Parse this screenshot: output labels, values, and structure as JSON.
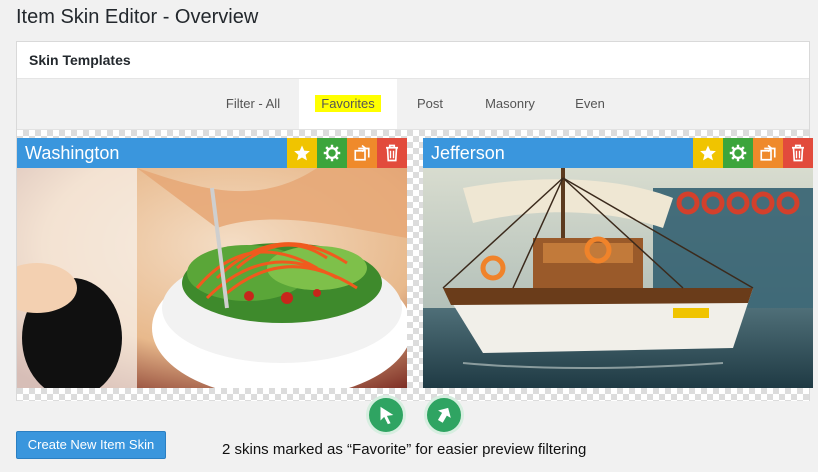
{
  "page": {
    "title": "Item Skin Editor - Overview"
  },
  "panel": {
    "title": "Skin Templates"
  },
  "filters": [
    {
      "label": "Filter - All",
      "active": false
    },
    {
      "label": "Favorites",
      "active": true
    },
    {
      "label": "Post",
      "active": false
    },
    {
      "label": "Masonry",
      "active": false
    },
    {
      "label": "Even",
      "active": false
    }
  ],
  "skins": [
    {
      "name": "Washington",
      "image": "salad-bowl-photo"
    },
    {
      "name": "Jefferson",
      "image": "sailing-boat-photo"
    }
  ],
  "tools": {
    "favorite_icon": "star-icon",
    "settings_icon": "gear-icon",
    "duplicate_icon": "duplicate-icon",
    "delete_icon": "trash-icon"
  },
  "colors": {
    "accent": "#3a96dd",
    "favorite": "#f0c400",
    "settings": "#3ca53c",
    "duplicate": "#ef8a2b",
    "delete": "#e24b3c",
    "highlight": "#ffff00",
    "cursor": "#2fa462"
  },
  "actions": {
    "create_label": "Create New Item Skin"
  },
  "caption": "2 skins marked as “Favorite” for easier preview filtering"
}
